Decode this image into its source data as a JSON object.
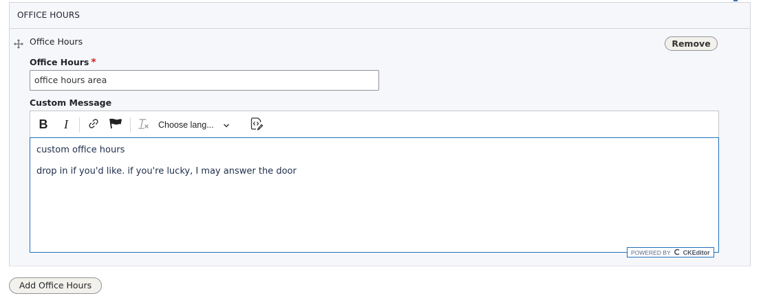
{
  "section": {
    "title": "OFFICE HOURS"
  },
  "item": {
    "title": "Office Hours",
    "remove_label": "Remove",
    "drag_icon": "move-cross-icon"
  },
  "field_office_hours": {
    "label": "Office Hours",
    "required_marker": "*",
    "value": "office hours area"
  },
  "field_custom_message": {
    "label": "Custom Message",
    "toolbar": {
      "bold": "B",
      "italic": "I",
      "link_icon": "link-icon",
      "anchor_icon": "flag-icon",
      "remove_format_icon": "remove-format-icon",
      "language_select": "Choose lang...",
      "source_icon": "source-edit-icon"
    },
    "content": [
      "custom office hours",
      "drop in if you'd like. if you're lucky, I may answer the door"
    ],
    "powered_by": "POWERED BY",
    "powered_brand": "CKEditor"
  },
  "add_button_label": "Add Office Hours",
  "colors": {
    "focus_border": "#1f6fb8",
    "required": "#d72222",
    "section_bg": "#f5f7fb"
  }
}
